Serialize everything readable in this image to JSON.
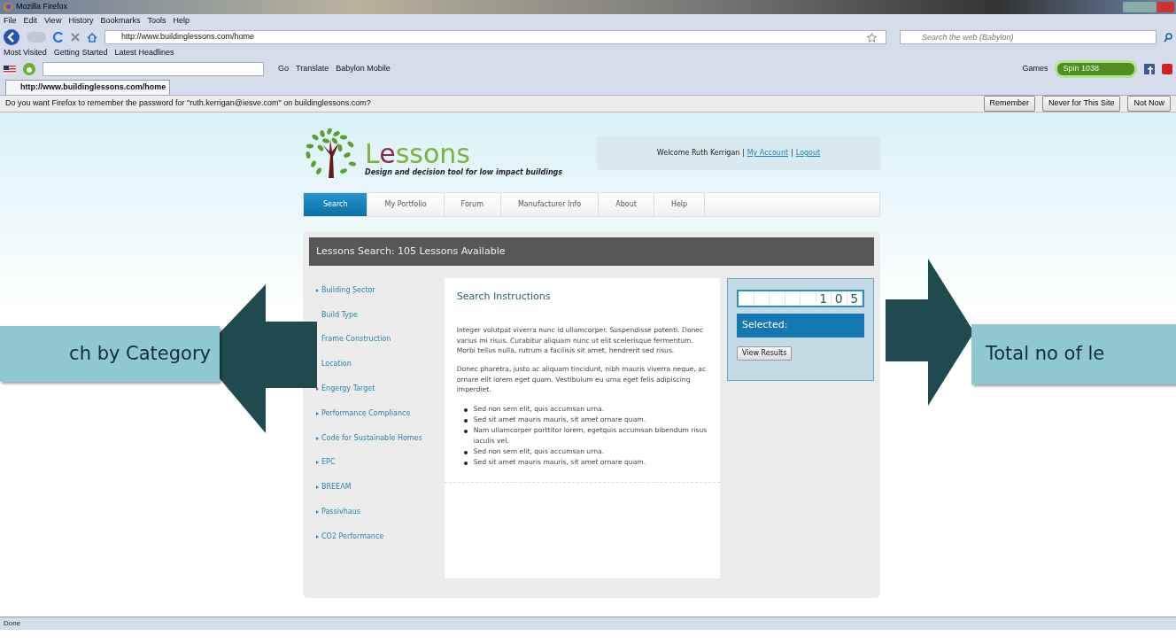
{
  "browser": {
    "title": "Mozilla Firefox",
    "menu": [
      "File",
      "Edit",
      "View",
      "History",
      "Bookmarks",
      "Tools",
      "Help"
    ],
    "url": "http://www.buildinglessons.com/home",
    "search_placeholder": "Search the web (Babylon)",
    "bookmarks": [
      "Most Visited",
      "Getting Started",
      "Latest Headlines"
    ],
    "toolbar": {
      "go": "Go",
      "translate": "Translate",
      "mobile": "Babylon Mobile",
      "games": "Games",
      "radio": "Spin 1038"
    },
    "tabs": [
      {
        "label": "http://www.buildinglessons.com/home",
        "selected": true
      }
    ],
    "notification": {
      "text": "Do you want Firefox to remember the password for \"ruth.kerrigan@iesve.com\" on buildinglessons.com?",
      "buttons": [
        "Remember",
        "Never for This Site",
        "Not Now"
      ]
    }
  },
  "site": {
    "logo": "Lessons",
    "tagline": "Design and decision tool for low impact buildings",
    "welcome": "Welcome Ruth Kerrigan |",
    "links": [
      "My Account",
      "Logout"
    ],
    "link_separator": "|",
    "nav": [
      {
        "label": "Search",
        "selected": true
      },
      {
        "label": "My Portfolio",
        "selected": false
      },
      {
        "label": "Forum",
        "selected": false
      },
      {
        "label": "Manufacturer Info",
        "selected": false
      },
      {
        "label": "About",
        "selected": false
      },
      {
        "label": "Help",
        "selected": false
      }
    ],
    "panel_title": "Lessons Search: 105 Lessons Available",
    "categories": [
      {
        "label": "Building Sector",
        "marker": true
      },
      {
        "label": "Build Type",
        "marker": false
      },
      {
        "label": "Frame Construction",
        "marker": false
      },
      {
        "label": "Location",
        "marker": false
      },
      {
        "label": "Engergy Target",
        "marker": true
      },
      {
        "label": "Performance Compliance",
        "marker": true
      },
      {
        "label": "Code for Sustainable Homes",
        "marker": true
      },
      {
        "label": "EPC",
        "marker": true
      },
      {
        "label": "BREEAM",
        "marker": true
      },
      {
        "label": "Passivhaus",
        "marker": true
      },
      {
        "label": "CO2 Performance",
        "marker": true
      }
    ],
    "instructions": {
      "title": "Search Instructions",
      "paragraphs": [
        "Integer volutpat viverra nunc id ullamcorper. Suspendisse potenti. Donec varius mi risus. Curabitur aliquam nunc ut elit scelerisque fermentum. Morbi tellus nulla, rutrum a facilisis sit amet, hendrerit sed risus.",
        "Donec pharetra, justo ac aliquam tincidunt, nibh mauris viverra neque, ac ornare elit lorem eget quam. Vestibulum eu urna eget felis adipiscing imperdiet."
      ],
      "bullets": [
        "Sed non sem elit, quis accumsan urna.",
        "Sed sit amet mauris mauris, sit amet ornare quam.",
        "Nam ullamcorper porttitor lorem, egetquis accumsan bibendum risus iaculis vel.",
        "Sed non sem elit, quis accumsan urna.",
        "Sed sit amet mauris mauris, sit amet ornare quam."
      ]
    },
    "counter_digits": [
      "1",
      "0",
      "5"
    ],
    "selected_label": "Selected:",
    "results_button": "View Results"
  },
  "callouts": [
    {
      "text": "ch by Category",
      "kind": "left"
    },
    {
      "text": "Total no of le",
      "kind": "right"
    }
  ],
  "status_bar": "Done"
}
